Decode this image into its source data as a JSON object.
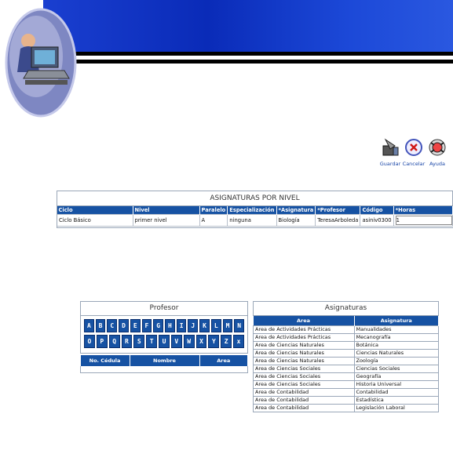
{
  "toolbar": {
    "guardar": "Guardar",
    "cancelar": "Cancelar",
    "ayuda": "Ayuda"
  },
  "nivel": {
    "title": "ASIGNATURAS POR NIVEL",
    "headers": [
      "Ciclo",
      "Nivel",
      "Paralelo",
      "Especialización",
      "*Asignatura",
      "*Profesor",
      "Código",
      "*Horas"
    ],
    "row": [
      "Ciclo Básico",
      "primer nivel",
      "A",
      "ninguna",
      "Biología",
      "TeresaArboleda",
      "asiniv0300",
      "1"
    ]
  },
  "profesor": {
    "title": "Profesor",
    "letters_row1": [
      "A",
      "B",
      "C",
      "D",
      "E",
      "F",
      "G",
      "H",
      "I",
      "J",
      "K",
      "L",
      "M",
      "N"
    ],
    "letters_row2": [
      "O",
      "P",
      "Q",
      "R",
      "S",
      "T",
      "U",
      "V",
      "W",
      "X",
      "Y",
      "Z",
      "x"
    ],
    "headers": [
      "No. Cédula",
      "Nombre",
      "Area"
    ]
  },
  "asignaturas": {
    "title": "Asignaturas",
    "headers": [
      "Area",
      "Asignatura"
    ],
    "rows": [
      [
        "Area de Actividades Prácticas",
        "Manualidades"
      ],
      [
        "Area de Actividades Prácticas",
        "Mecanografía"
      ],
      [
        "Area de Ciencias Naturales",
        "Botánica"
      ],
      [
        "Area de Ciencias Naturales",
        "Ciencias Naturales"
      ],
      [
        "Area de Ciencias Naturales",
        "Zoología"
      ],
      [
        "Area de Ciencias Sociales",
        "Ciencias Sociales"
      ],
      [
        "Area de Ciencias Sociales",
        "Geografía"
      ],
      [
        "Area de Ciencias Sociales",
        "Historia Universal"
      ],
      [
        "Area de Contabilidad",
        "Contabilidad"
      ],
      [
        "Area de Contabilidad",
        "Estadística"
      ],
      [
        "Area de Contabilidad",
        "Legislación Laboral"
      ]
    ]
  }
}
